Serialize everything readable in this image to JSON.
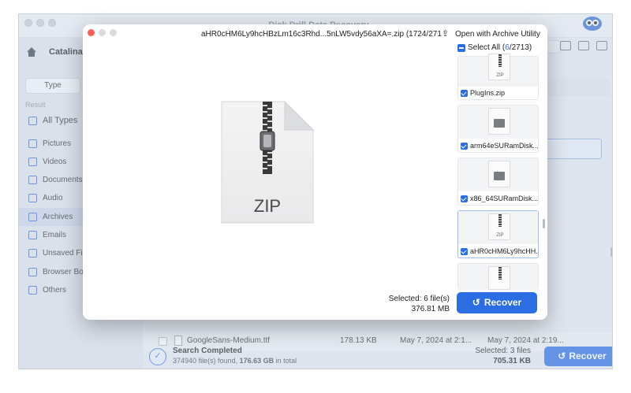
{
  "app": {
    "title": "Disk Drill Data Recovery",
    "disk_name": "Catalina -",
    "tab_type": "Type",
    "result_label": "Result",
    "sidebar": [
      {
        "label": "All Types",
        "icon": "grid-icon"
      },
      {
        "label": "Pictures",
        "icon": "picture-icon"
      },
      {
        "label": "Videos",
        "icon": "video-icon"
      },
      {
        "label": "Documents",
        "icon": "document-icon"
      },
      {
        "label": "Audio",
        "icon": "music-icon"
      },
      {
        "label": "Archives",
        "icon": "archive-icon"
      },
      {
        "label": "Emails",
        "icon": "mail-icon"
      },
      {
        "label": "Unsaved Files",
        "icon": "clock-icon"
      },
      {
        "label": "Browser Bookmarks",
        "icon": "bookmark-icon"
      },
      {
        "label": "Others",
        "icon": "others-icon"
      }
    ],
    "file_row": {
      "name": "GoogleSans-Medium.ttf",
      "size": "178.13 KB",
      "created": "May 7, 2024 at 2:1...",
      "modified": "May 7, 2024 at 2:19..."
    },
    "status": {
      "title": "Search Completed",
      "count": "374940",
      "found_text": "file(s) found,",
      "size": "176.63 GB",
      "in_total": "in total"
    },
    "selected_label": "Selected: 3 files",
    "selected_size": "705.31 KB",
    "recover_label": "Recover"
  },
  "modal": {
    "title": "aHR0cHM6Ly9hcHBzLm16c3Rhd...5nLW5vdy56aXA=.zip (1724/2713)",
    "open_with": "Open with Archive Utility",
    "preview_label": "ZIP",
    "select_all_prefix": "Select All (",
    "select_all_count": "6",
    "select_all_suffix": "/2713)",
    "thumbnails": [
      {
        "name": "PlugIns.zip",
        "kind": "ZIP",
        "checked": true
      },
      {
        "name": "arm64eSURamDisk....",
        "kind": "disk",
        "checked": true
      },
      {
        "name": "x86_64SURamDisk....",
        "kind": "disk",
        "checked": true
      },
      {
        "name": "aHR0cHM6Ly9hcHH...",
        "kind": "ZIP",
        "checked": true
      }
    ],
    "selected_label": "Selected: 6 file(s)",
    "selected_size": "376.81 MB",
    "recover_label": "Recover"
  },
  "colors": {
    "accent": "#2b6de3"
  }
}
